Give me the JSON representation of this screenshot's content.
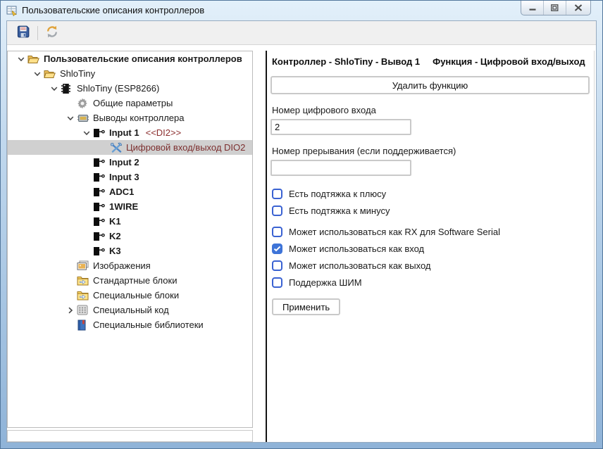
{
  "window": {
    "title": "Пользовательские описания контроллеров",
    "app_icon": "form-edit-icon",
    "buttons": [
      {
        "icon": "minimize-icon"
      },
      {
        "icon": "maximize-icon"
      },
      {
        "icon": "close-icon"
      }
    ]
  },
  "toolbar": {
    "buttons": [
      {
        "icon": "save-icon"
      },
      {
        "icon": "refresh-icon"
      }
    ]
  },
  "tree": {
    "items": [
      {
        "label": "Пользовательские описания контроллеров",
        "level": 0,
        "expand": "expanded",
        "icon": "folder-open-icon",
        "bold": true
      },
      {
        "label": "ShloTiny",
        "level": 1,
        "expand": "expanded",
        "icon": "folder-open-icon"
      },
      {
        "label": "ShloTiny (ESP8266)",
        "level": 2,
        "expand": "expanded",
        "icon": "chip-icon"
      },
      {
        "label": "Общие параметры",
        "level": 3,
        "expand": "none",
        "icon": "gear-icon"
      },
      {
        "label": "Выводы контроллера",
        "level": 3,
        "expand": "expanded",
        "icon": "mcu-icon"
      },
      {
        "label": "Input 1",
        "suffix": "<<DI2>>",
        "level": 4,
        "expand": "expanded",
        "icon": "pin-icon",
        "bold": true
      },
      {
        "label": "Цифровой вход/выход DIO2",
        "level": 5,
        "expand": "none",
        "icon": "tools-icon",
        "selected": true
      },
      {
        "label": "Input 2",
        "level": 4,
        "expand": "none",
        "icon": "pin-icon",
        "bold": true
      },
      {
        "label": "Input 3",
        "level": 4,
        "expand": "none",
        "icon": "pin-icon",
        "bold": true
      },
      {
        "label": "ADC1",
        "level": 4,
        "expand": "none",
        "icon": "pin-icon",
        "bold": true
      },
      {
        "label": "1WIRE",
        "level": 4,
        "expand": "none",
        "icon": "pin-icon",
        "bold": true
      },
      {
        "label": "K1",
        "level": 4,
        "expand": "none",
        "icon": "pin-icon",
        "bold": true
      },
      {
        "label": "K2",
        "level": 4,
        "expand": "none",
        "icon": "pin-icon",
        "bold": true
      },
      {
        "label": "K3",
        "level": 4,
        "expand": "none",
        "icon": "pin-icon",
        "bold": true
      },
      {
        "label": "Изображения",
        "level": 3,
        "expand": "none",
        "icon": "images-icon"
      },
      {
        "label": "Стандартные блоки",
        "level": 3,
        "expand": "none",
        "icon": "folder-blocks-icon"
      },
      {
        "label": "Специальные блоки",
        "level": 3,
        "expand": "none",
        "icon": "folder-blocks-icon"
      },
      {
        "label": "Специальный код",
        "level": 3,
        "expand": "collapsed",
        "icon": "code-icon"
      },
      {
        "label": "Специальные библиотеки",
        "level": 3,
        "expand": "none",
        "icon": "library-icon"
      }
    ]
  },
  "panel": {
    "header_left": "Контроллер - ShloTiny - Вывод 1",
    "header_right": "Функция - Цифровой вход/выход",
    "delete_button_label": "Удалить функцию",
    "fields": [
      {
        "label": "Номер цифрового входа",
        "value": "2"
      },
      {
        "label": "Номер прерывания (если поддерживается)",
        "value": ""
      }
    ],
    "checkboxes": [
      {
        "label": "Есть подтяжка к плюсу",
        "checked": false
      },
      {
        "label": "Есть подтяжка к минусу",
        "checked": false
      },
      {
        "label": "Может использоваться как RX для Software Serial",
        "checked": false
      },
      {
        "label": "Может использоваться как вход",
        "checked": true
      },
      {
        "label": "Может использоваться как выход",
        "checked": false
      },
      {
        "label": "Поддержка ШИМ",
        "checked": false
      }
    ],
    "apply_button_label": "Применить"
  },
  "colors": {
    "checkbox_blue": "#3e74d8",
    "selected_row_bg": "#d0d0d0",
    "selected_row_text": "#7c2f2f",
    "pin_suffix_text": "#8b2e2e",
    "window_frame": "#a5c4e2"
  }
}
